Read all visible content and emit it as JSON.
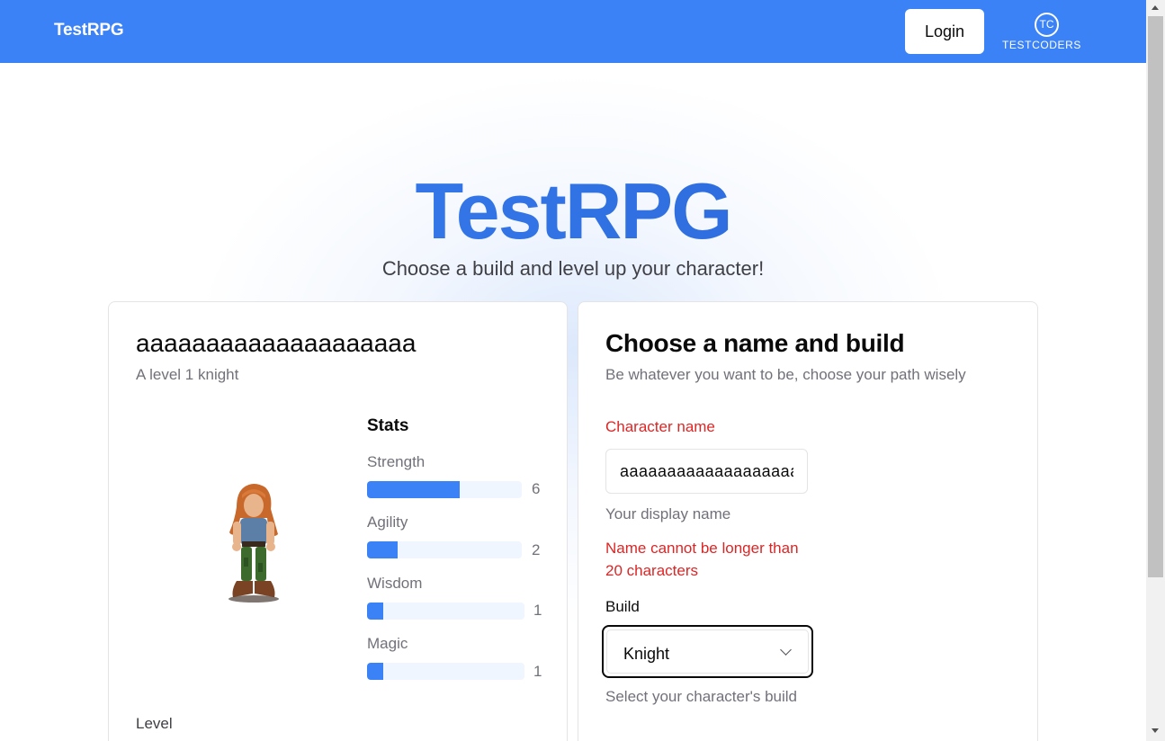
{
  "header": {
    "brand": "TestRPG",
    "login_label": "Login",
    "partner_logo_text": "TESTCODERS",
    "partner_logo_mark": "TC",
    "bg_color": "#3b82f6"
  },
  "hero": {
    "title": "TestRPG",
    "subtitle": "Choose a build and level up your character!"
  },
  "character": {
    "name": "aaaaaaaaaaaaaaaaaaaa",
    "description": "A level 1 knight",
    "stats_title": "Stats",
    "stats": [
      {
        "label": "Strength",
        "value": "6",
        "fraction": 0.6
      },
      {
        "label": "Agility",
        "value": "2",
        "fraction": 0.2
      },
      {
        "label": "Wisdom",
        "value": "1",
        "fraction": 0.1
      },
      {
        "label": "Magic",
        "value": "1",
        "fraction": 0.1
      }
    ],
    "level_label": "Level"
  },
  "form": {
    "title": "Choose a name and build",
    "description": "Be whatever you want to be, choose your path wisely",
    "name_label": "Character name",
    "name_value": "aaaaaaaaaaaaaaaaaaaa",
    "name_help": "Your display name",
    "name_error": "Name cannot be longer than 20 characters",
    "build_label": "Build",
    "build_value": "Knight",
    "build_help": "Select your character's build"
  },
  "colors": {
    "accent": "#3b82f6",
    "error": "#dc2626",
    "muted_text": "#71717a"
  }
}
